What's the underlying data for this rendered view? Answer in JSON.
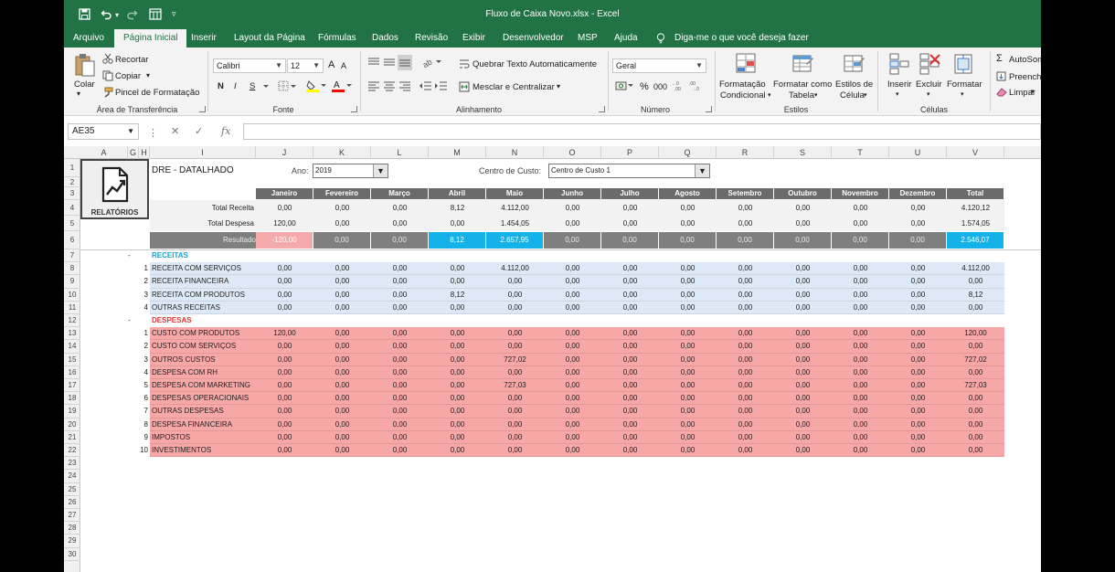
{
  "app": {
    "title": "Fluxo de Caixa Novo.xlsx  -  Excel"
  },
  "tabs": [
    "Arquivo",
    "Página Inicial",
    "Inserir",
    "Layout da Página",
    "Fórmulas",
    "Dados",
    "Revisão",
    "Exibir",
    "Desenvolvedor",
    "MSP",
    "Ajuda"
  ],
  "tellme": "Diga-me o que você deseja fazer",
  "ribbon": {
    "clipboard": {
      "paste": "Colar",
      "cut": "Recortar",
      "copy": "Copiar",
      "format_painter": "Pincel de Formatação",
      "label": "Área de Transferência"
    },
    "font": {
      "name": "Calibri",
      "size": "12",
      "label": "Fonte",
      "bold": "N",
      "italic": "I",
      "underline": "S",
      "inc": "A",
      "dec": "A"
    },
    "alignment": {
      "wrap": "Quebrar Texto Automaticamente",
      "merge": "Mesclar e Centralizar",
      "label": "Alinhamento"
    },
    "number": {
      "format": "Geral",
      "label": "Número",
      "percent": "%",
      "thousands": "000"
    },
    "styles": {
      "cond1": "Formatação",
      "cond2": "Condicional",
      "table1": "Formatar como",
      "table2": "Tabela",
      "cell1": "Estilos de",
      "cell2": "Célula",
      "label": "Estilos"
    },
    "cells": {
      "insert": "Inserir",
      "delete": "Excluir",
      "format": "Formatar",
      "label": "Células"
    },
    "editing": {
      "autosum": "AutoSom",
      "fill": "Preench",
      "clear": "Limpar"
    }
  },
  "formula_bar": {
    "namebox": "AE35",
    "fx": "fx",
    "value": ""
  },
  "columns": [
    {
      "id": "A",
      "w": 52
    },
    {
      "id": "G",
      "w": 12
    },
    {
      "id": "H",
      "w": 12
    },
    {
      "id": "I",
      "w": 116
    },
    {
      "id": "J",
      "w": 63
    },
    {
      "id": "K",
      "w": 63
    },
    {
      "id": "L",
      "w": 63
    },
    {
      "id": "M",
      "w": 63
    },
    {
      "id": "N",
      "w": 63
    },
    {
      "id": "O",
      "w": 63
    },
    {
      "id": "P",
      "w": 63
    },
    {
      "id": "Q",
      "w": 63
    },
    {
      "id": "R",
      "w": 63
    },
    {
      "id": "S",
      "w": 63
    },
    {
      "id": "T",
      "w": 63
    },
    {
      "id": "U",
      "w": 63
    },
    {
      "id": "V",
      "w": 63
    }
  ],
  "row_numbers": [
    "1",
    "2",
    "3",
    "4",
    "5",
    "6",
    "7",
    "8",
    "9",
    "10",
    "11",
    "12",
    "13",
    "14",
    "15",
    "16",
    "17",
    "18",
    "19",
    "20",
    "21",
    "22",
    "23",
    "24",
    "25",
    "26",
    "27",
    "28",
    "29",
    "30"
  ],
  "sheet": {
    "title": "DRE - DATALHADO",
    "report_button": "RELATÓRIOS",
    "year_label": "Ano:",
    "year_value": "2019",
    "center_label": "Centro de Custo:",
    "center_value": "Centro de Custo 1",
    "months": [
      "Janeiro",
      "Fevereiro",
      "Março",
      "Abril",
      "Maio",
      "Junho",
      "Julho",
      "Agosto",
      "Setembro",
      "Outubro",
      "Novembro",
      "Dezembro",
      "Total"
    ],
    "summary": [
      {
        "label": "Total Receita",
        "values": [
          "0,00",
          "0,00",
          "0,00",
          "8,12",
          "4.112,00",
          "0,00",
          "0,00",
          "0,00",
          "0,00",
          "0,00",
          "0,00",
          "0,00",
          "4.120,12"
        ]
      },
      {
        "label": "Total Despesa",
        "values": [
          "120,00",
          "0,00",
          "0,00",
          "0,00",
          "1.454,05",
          "0,00",
          "0,00",
          "0,00",
          "0,00",
          "0,00",
          "0,00",
          "0,00",
          "1.574,05"
        ]
      }
    ],
    "result": {
      "label": "Resultado",
      "values": [
        "-120,00",
        "0,00",
        "0,00",
        "8,12",
        "2.657,95",
        "0,00",
        "0,00",
        "0,00",
        "0,00",
        "0,00",
        "0,00",
        "0,00",
        "2.546,07"
      ]
    },
    "receitas": {
      "marker": "-",
      "title": "RECEITAS",
      "rows": [
        {
          "n": "1",
          "name": "RECEITA COM SERVIÇOS",
          "values": [
            "0,00",
            "0,00",
            "0,00",
            "0,00",
            "4.112,00",
            "0,00",
            "0,00",
            "0,00",
            "0,00",
            "0,00",
            "0,00",
            "0,00",
            "4.112,00"
          ]
        },
        {
          "n": "2",
          "name": "RECEITA FINANCEIRA",
          "values": [
            "0,00",
            "0,00",
            "0,00",
            "0,00",
            "0,00",
            "0,00",
            "0,00",
            "0,00",
            "0,00",
            "0,00",
            "0,00",
            "0,00",
            "0,00"
          ]
        },
        {
          "n": "3",
          "name": "RECEITA COM PRODUTOS",
          "values": [
            "0,00",
            "0,00",
            "0,00",
            "8,12",
            "0,00",
            "0,00",
            "0,00",
            "0,00",
            "0,00",
            "0,00",
            "0,00",
            "0,00",
            "8,12"
          ]
        },
        {
          "n": "4",
          "name": "OUTRAS RECEITAS",
          "values": [
            "0,00",
            "0,00",
            "0,00",
            "0,00",
            "0,00",
            "0,00",
            "0,00",
            "0,00",
            "0,00",
            "0,00",
            "0,00",
            "0,00",
            "0,00"
          ]
        }
      ]
    },
    "despesas": {
      "marker": "-",
      "title": "DESPESAS",
      "rows": [
        {
          "n": "1",
          "name": "CUSTO COM PRODUTOS",
          "values": [
            "120,00",
            "0,00",
            "0,00",
            "0,00",
            "0,00",
            "0,00",
            "0,00",
            "0,00",
            "0,00",
            "0,00",
            "0,00",
            "0,00",
            "120,00"
          ]
        },
        {
          "n": "2",
          "name": "CUSTO COM SERVIÇOS",
          "values": [
            "0,00",
            "0,00",
            "0,00",
            "0,00",
            "0,00",
            "0,00",
            "0,00",
            "0,00",
            "0,00",
            "0,00",
            "0,00",
            "0,00",
            "0,00"
          ]
        },
        {
          "n": "3",
          "name": "OUTROS CUSTOS",
          "values": [
            "0,00",
            "0,00",
            "0,00",
            "0,00",
            "727,02",
            "0,00",
            "0,00",
            "0,00",
            "0,00",
            "0,00",
            "0,00",
            "0,00",
            "727,02"
          ]
        },
        {
          "n": "4",
          "name": "DESPESA COM RH",
          "values": [
            "0,00",
            "0,00",
            "0,00",
            "0,00",
            "0,00",
            "0,00",
            "0,00",
            "0,00",
            "0,00",
            "0,00",
            "0,00",
            "0,00",
            "0,00"
          ]
        },
        {
          "n": "5",
          "name": "DESPESA COM MARKETING",
          "values": [
            "0,00",
            "0,00",
            "0,00",
            "0,00",
            "727,03",
            "0,00",
            "0,00",
            "0,00",
            "0,00",
            "0,00",
            "0,00",
            "0,00",
            "727,03"
          ]
        },
        {
          "n": "6",
          "name": "DESPESAS OPERACIONAIS",
          "values": [
            "0,00",
            "0,00",
            "0,00",
            "0,00",
            "0,00",
            "0,00",
            "0,00",
            "0,00",
            "0,00",
            "0,00",
            "0,00",
            "0,00",
            "0,00"
          ]
        },
        {
          "n": "7",
          "name": "OUTRAS DESPESAS",
          "values": [
            "0,00",
            "0,00",
            "0,00",
            "0,00",
            "0,00",
            "0,00",
            "0,00",
            "0,00",
            "0,00",
            "0,00",
            "0,00",
            "0,00",
            "0,00"
          ]
        },
        {
          "n": "8",
          "name": "DESPESA FINANCEIRA",
          "values": [
            "0,00",
            "0,00",
            "0,00",
            "0,00",
            "0,00",
            "0,00",
            "0,00",
            "0,00",
            "0,00",
            "0,00",
            "0,00",
            "0,00",
            "0,00"
          ]
        },
        {
          "n": "9",
          "name": "IMPOSTOS",
          "values": [
            "0,00",
            "0,00",
            "0,00",
            "0,00",
            "0,00",
            "0,00",
            "0,00",
            "0,00",
            "0,00",
            "0,00",
            "0,00",
            "0,00",
            "0,00"
          ]
        },
        {
          "n": "10",
          "name": "INVESTIMENTOS",
          "values": [
            "0,00",
            "0,00",
            "0,00",
            "0,00",
            "0,00",
            "0,00",
            "0,00",
            "0,00",
            "0,00",
            "0,00",
            "0,00",
            "0,00",
            "0,00"
          ]
        }
      ]
    }
  },
  "colors": {
    "excel_green": "#217346",
    "month_header": "#6b6b6b",
    "summary_bg": "#f2f2f2",
    "result_gray": "#7f7f7f",
    "result_neg": "#f4aaaa",
    "result_pos": "#14b2e8",
    "receitas_bg": "#dde9f6",
    "despesas_bg": "#f8a7a7",
    "receitas_title": "#17a2c9",
    "despesas_title": "#e03535"
  }
}
